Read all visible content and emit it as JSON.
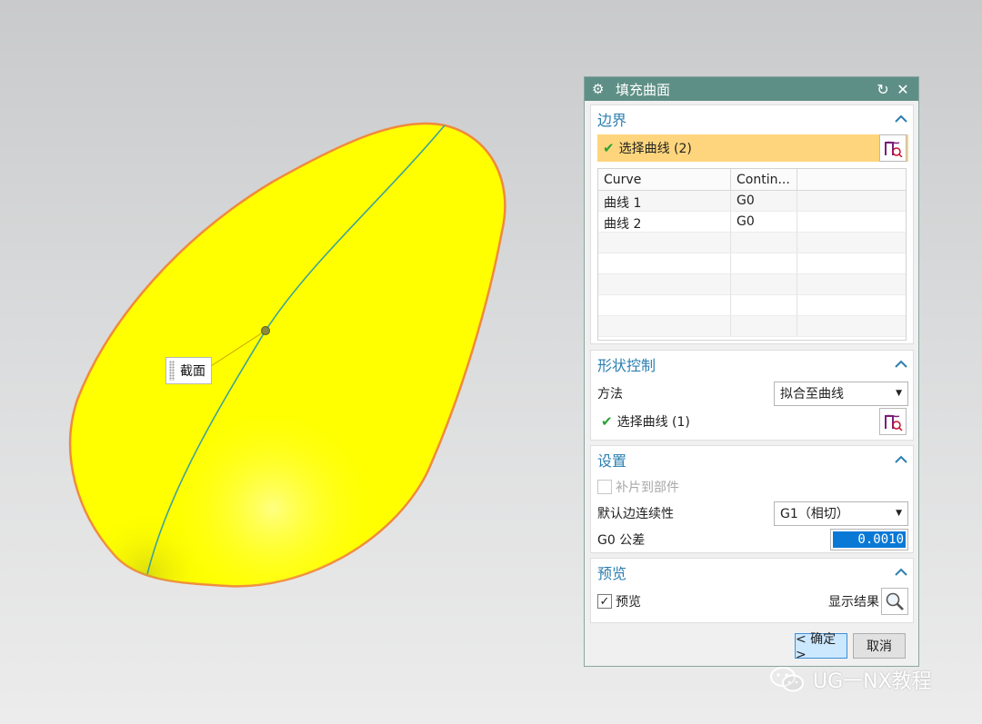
{
  "viewport": {
    "section_tag": "截面",
    "surface_color": "#ffff00",
    "edge_color": "#f08a3c",
    "center_curve_color": "#3ea39a"
  },
  "dialog": {
    "title": "填充曲面",
    "title_icon": "gear-icon",
    "boundary": {
      "title": "边界",
      "select_curve_label": "选择曲线 (2)",
      "table": {
        "headers": [
          "Curve",
          "Contin..."
        ],
        "rows": [
          [
            "曲线 1",
            "G0"
          ],
          [
            "曲线 2",
            "G0"
          ]
        ]
      }
    },
    "shape_control": {
      "title": "形状控制",
      "method_label": "方法",
      "method_value": "拟合至曲线",
      "select_curve_label": "选择曲线 (1)"
    },
    "settings": {
      "title": "设置",
      "patch_to_part_label": "补片到部件",
      "continuity_label": "默认边连续性",
      "continuity_value": "G1（相切）",
      "tolerance_label": "G0 公差",
      "tolerance_value": "0.0010"
    },
    "preview": {
      "title": "预览",
      "preview_label": "预览",
      "preview_checked": true,
      "show_result_label": "显示结果"
    },
    "ok_label": "< 确定 >",
    "cancel_label": "取消",
    "accent_color": "#5e8f86"
  },
  "watermark": {
    "text": "UG一NX教程"
  }
}
